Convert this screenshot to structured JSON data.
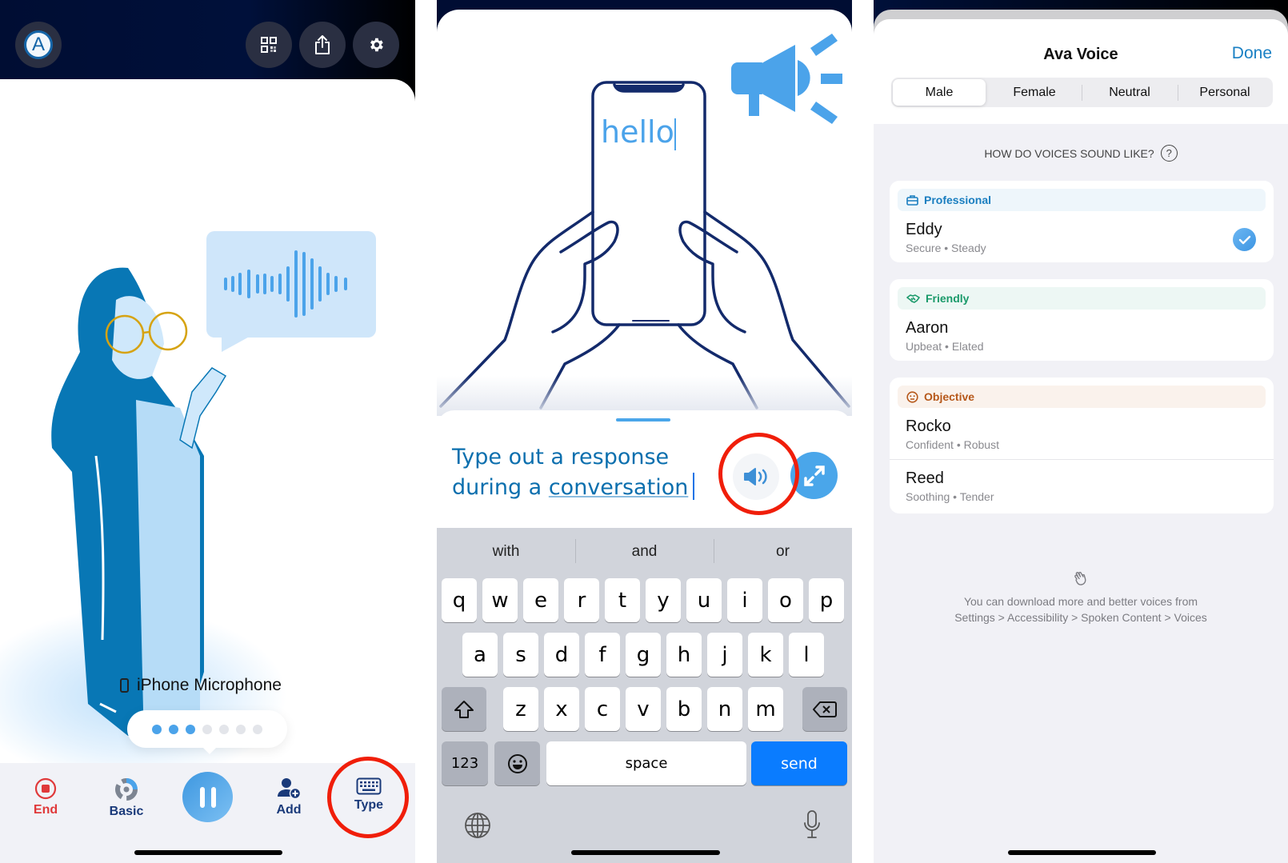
{
  "panel1": {
    "header": {
      "avatar_letter": "A",
      "buttons": [
        "qr-code",
        "share",
        "settings"
      ]
    },
    "illustration": {
      "description": "woman holding phone speaking, speech bubble with sound waveform"
    },
    "microphone_label": "iPhone Microphone",
    "level_dots": {
      "total": 7,
      "active": 3
    },
    "toolbar": {
      "end": "End",
      "basic": "Basic",
      "add": "Add",
      "type": "Type"
    },
    "colors": {
      "end": "#e0393a",
      "nav": "#1a3a7a",
      "accent": "#4ba3ea",
      "highlight_ring": "#f01e0a"
    }
  },
  "panel2": {
    "illustration": {
      "phone_text": "hello"
    },
    "compose": {
      "line1": "Type out a response",
      "line2_plain": "during a ",
      "line2_underlined": "conversation"
    },
    "keyboard": {
      "suggestions": [
        "with",
        "and",
        "or"
      ],
      "row1": [
        "q",
        "w",
        "e",
        "r",
        "t",
        "y",
        "u",
        "i",
        "o",
        "p"
      ],
      "row2": [
        "a",
        "s",
        "d",
        "f",
        "g",
        "h",
        "j",
        "k",
        "l"
      ],
      "row3": [
        "z",
        "x",
        "c",
        "v",
        "b",
        "n",
        "m"
      ],
      "numbers_key": "123",
      "space_key": "space",
      "send_key": "send"
    }
  },
  "panel3": {
    "title": "Ava Voice",
    "done": "Done",
    "segments": [
      {
        "label": "Male",
        "active": true
      },
      {
        "label": "Female",
        "active": false
      },
      {
        "label": "Neutral",
        "active": false
      },
      {
        "label": "Personal",
        "active": false
      }
    ],
    "help_text": "HOW DO VOICES SOUND LIKE?",
    "groups": [
      {
        "label": "Professional",
        "icon": "briefcase-icon",
        "color": "#1a7ec0",
        "bg": "#eef6fb",
        "voices": [
          {
            "name": "Eddy",
            "desc": "Secure • Steady",
            "selected": true
          }
        ]
      },
      {
        "label": "Friendly",
        "icon": "handshake-icon",
        "color": "#1a9a6a",
        "bg": "#edf7f4",
        "voices": [
          {
            "name": "Aaron",
            "desc": "Upbeat • Elated",
            "selected": false
          }
        ]
      },
      {
        "label": "Objective",
        "icon": "neutral-face-icon",
        "color": "#b6581a",
        "bg": "#faf2ec",
        "voices": [
          {
            "name": "Rocko",
            "desc": "Confident • Robust",
            "selected": false
          },
          {
            "name": "Reed",
            "desc": "Soothing • Tender",
            "selected": false
          }
        ]
      }
    ],
    "footer_line1": "You can download more and better voices from",
    "footer_line2": "Settings > Accessibility > Spoken Content > Voices"
  }
}
